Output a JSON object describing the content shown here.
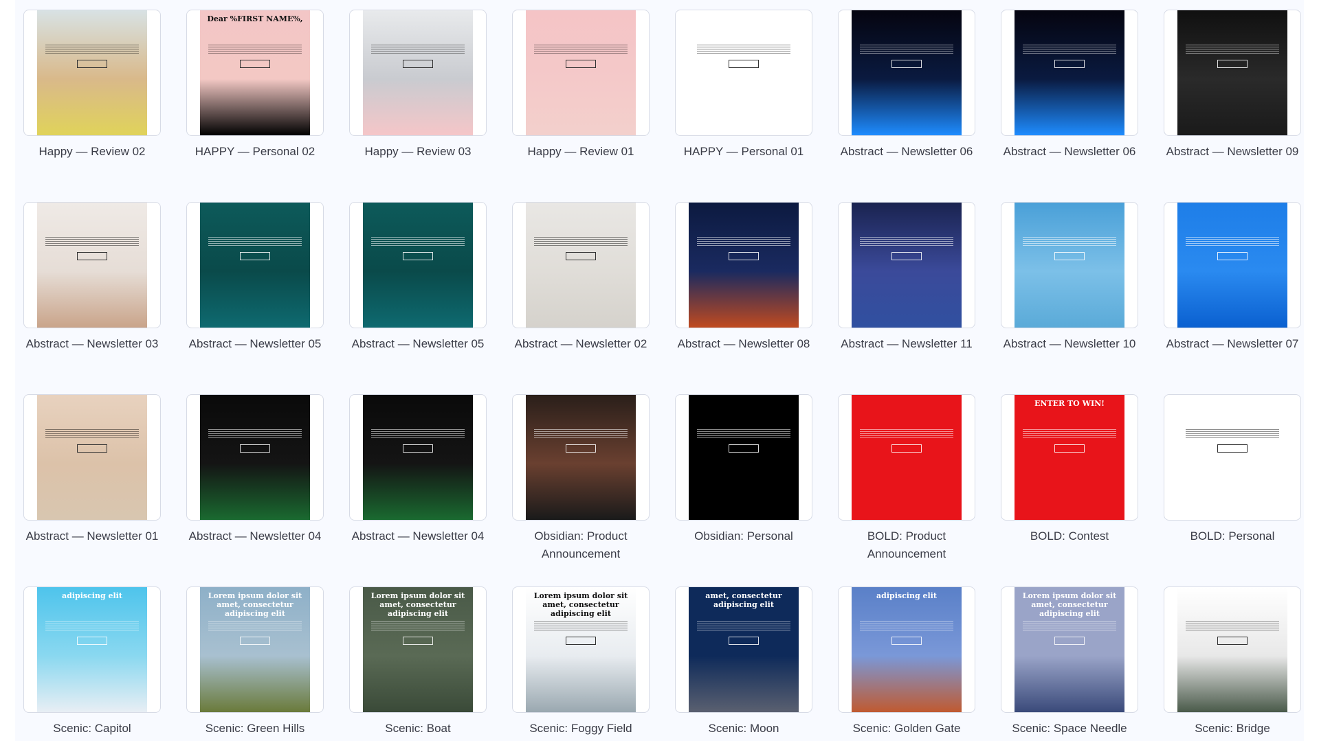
{
  "templates": [
    {
      "label": "Happy — Review 02",
      "colors": [
        "#d8e2e4",
        "#d9b98a",
        "#e0d35a"
      ],
      "headline": "",
      "light": true
    },
    {
      "label": "HAPPY — Personal 02",
      "colors": [
        "#f3c6c6",
        "#f3c8c4",
        "#000000"
      ],
      "headline": "Dear %FIRST NAME%,",
      "light": true
    },
    {
      "label": "Happy — Review 03",
      "colors": [
        "#e8eaec",
        "#c9cbd0",
        "#f5c6c8"
      ],
      "headline": "",
      "light": true
    },
    {
      "label": "Happy — Review 01",
      "colors": [
        "#f5c4c6",
        "#f4c9c9",
        "#f3d0cc"
      ],
      "headline": "",
      "light": true
    },
    {
      "label": "HAPPY — Personal 01",
      "colors": [
        "#ffffff",
        "#ffffff",
        "#ffffff"
      ],
      "headline": "",
      "light": true
    },
    {
      "label": "Abstract — Newsletter 06",
      "colors": [
        "#050510",
        "#0a1a40",
        "#1e8cff"
      ],
      "headline": "",
      "light": false
    },
    {
      "label": "Abstract — Newsletter 06",
      "colors": [
        "#050510",
        "#0a1a40",
        "#1e8cff"
      ],
      "headline": "",
      "light": false
    },
    {
      "label": "Abstract — Newsletter 09",
      "colors": [
        "#101010",
        "#2a2a2a",
        "#1a1a1a"
      ],
      "headline": "",
      "light": false
    },
    {
      "label": "Abstract — Newsletter 03",
      "colors": [
        "#efeae6",
        "#e6ddd6",
        "#c9a48a"
      ],
      "headline": "",
      "light": true
    },
    {
      "label": "Abstract — Newsletter 05",
      "colors": [
        "#0d5a5a",
        "#0a4a4a",
        "#0e6a70"
      ],
      "headline": "",
      "light": false
    },
    {
      "label": "Abstract — Newsletter 05",
      "colors": [
        "#0d5a5a",
        "#0a4a4a",
        "#0e6a70"
      ],
      "headline": "",
      "light": false
    },
    {
      "label": "Abstract — Newsletter 02",
      "colors": [
        "#e9e7e4",
        "#e0ddd8",
        "#d5d2cc"
      ],
      "headline": "",
      "light": true
    },
    {
      "label": "Abstract — Newsletter 08",
      "colors": [
        "#0c1a40",
        "#1a2a60",
        "#c04a20"
      ],
      "headline": "",
      "light": false
    },
    {
      "label": "Abstract — Newsletter 11",
      "colors": [
        "#1a2350",
        "#3b4a9a",
        "#3050a0"
      ],
      "headline": "",
      "light": false
    },
    {
      "label": "Abstract — Newsletter 10",
      "colors": [
        "#4aa0d8",
        "#7cc0e8",
        "#5aaad8"
      ],
      "headline": "",
      "light": false
    },
    {
      "label": "Abstract — Newsletter 07",
      "colors": [
        "#1e7ee8",
        "#2a8af0",
        "#0a60d0"
      ],
      "headline": "",
      "light": false
    },
    {
      "label": "Abstract — Newsletter 01",
      "colors": [
        "#e8d2bf",
        "#dcc2a9",
        "#d8c6b0"
      ],
      "headline": "",
      "light": true
    },
    {
      "label": "Abstract — Newsletter 04",
      "colors": [
        "#0a0a0a",
        "#141414",
        "#1a6a30"
      ],
      "headline": "",
      "light": false
    },
    {
      "label": "Abstract — Newsletter 04",
      "colors": [
        "#0a0a0a",
        "#141414",
        "#1a6a30"
      ],
      "headline": "",
      "light": false
    },
    {
      "label": "Obsidian: Product Announcement",
      "colors": [
        "#2a1f1a",
        "#6a4030",
        "#1a1a1a"
      ],
      "headline": "",
      "light": false
    },
    {
      "label": "Obsidian: Personal",
      "colors": [
        "#000000",
        "#000000",
        "#000000"
      ],
      "headline": "",
      "light": false
    },
    {
      "label": "BOLD: Product Announcement",
      "colors": [
        "#e8141a",
        "#e8141a",
        "#e8141a"
      ],
      "headline": "",
      "light": false
    },
    {
      "label": "BOLD: Contest",
      "colors": [
        "#e8141a",
        "#e8141a",
        "#e8141a"
      ],
      "headline": "ENTER TO WIN!",
      "light": false
    },
    {
      "label": "BOLD: Personal",
      "colors": [
        "#ffffff",
        "#ffffff",
        "#ffffff"
      ],
      "headline": "",
      "light": true
    },
    {
      "label": "Scenic: Capitol",
      "colors": [
        "#4ec4ec",
        "#8ad8f0",
        "#e8eef4"
      ],
      "headline": "adipiscing elit",
      "light": false
    },
    {
      "label": "Scenic: Green Hills",
      "colors": [
        "#8eb0c8",
        "#a8c0d0",
        "#6a7a3a"
      ],
      "headline": "Lorem ipsum dolor sit amet, consectetur adipiscing elit",
      "light": false
    },
    {
      "label": "Scenic: Boat",
      "colors": [
        "#4a5a48",
        "#5a6a55",
        "#3a4a38"
      ],
      "headline": "Lorem ipsum dolor sit amet, consectetur adipiscing elit",
      "light": false
    },
    {
      "label": "Scenic: Foggy Field",
      "colors": [
        "#ffffff",
        "#e8ecf0",
        "#9aa8b0"
      ],
      "headline": "Lorem ipsum dolor sit amet, consectetur adipiscing elit",
      "light": true
    },
    {
      "label": "Scenic: Moon",
      "colors": [
        "#0e2a5a",
        "#0e2a5a",
        "#5a6070"
      ],
      "headline": "amet, consectetur adipiscing elit",
      "light": false
    },
    {
      "label": "Scenic: Golden Gate",
      "colors": [
        "#5a80c8",
        "#7a98d8",
        "#c05a30"
      ],
      "headline": "adipiscing elit",
      "light": false
    },
    {
      "label": "Scenic: Space Needle",
      "colors": [
        "#9aa4c8",
        "#9aa4c8",
        "#3a4a7a"
      ],
      "headline": "Lorem ipsum dolor sit amet, consectetur adipiscing elit",
      "light": false
    },
    {
      "label": "Scenic: Bridge",
      "colors": [
        "#ffffff",
        "#e8e8e8",
        "#4a5a4a"
      ],
      "headline": "",
      "light": true
    }
  ]
}
